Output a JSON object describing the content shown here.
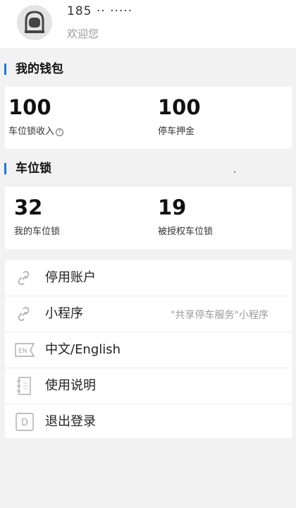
{
  "user": {
    "phone": "185 ·· ·····",
    "welcome": "欢迎您"
  },
  "wallet": {
    "title": "我的钱包",
    "items": [
      {
        "value": "100",
        "label": "车位锁收入",
        "has_info_icon": true
      },
      {
        "value": "100",
        "label": "停车押金"
      }
    ]
  },
  "locks": {
    "title": "车位锁",
    "items": [
      {
        "value": "32",
        "label": "我的车位锁"
      },
      {
        "value": "19",
        "label": "被授权车位锁"
      }
    ]
  },
  "menu": {
    "items": [
      {
        "label": "停用账户",
        "icon": "link-icon"
      },
      {
        "label": "小程序",
        "icon": "link-icon",
        "note": "\"共享停车服务\"小程序"
      },
      {
        "label": "中文/English",
        "icon": "language-en-icon",
        "icon_text": "EN"
      },
      {
        "label": "使用说明",
        "icon": "notebook-icon"
      },
      {
        "label": "退出登录",
        "icon": "logout-icon",
        "icon_text": "D"
      }
    ]
  },
  "colors": {
    "accent": "#1a7ad8",
    "background": "#f2f2f2",
    "card": "#ffffff",
    "muted_text": "#9a9a9a"
  }
}
